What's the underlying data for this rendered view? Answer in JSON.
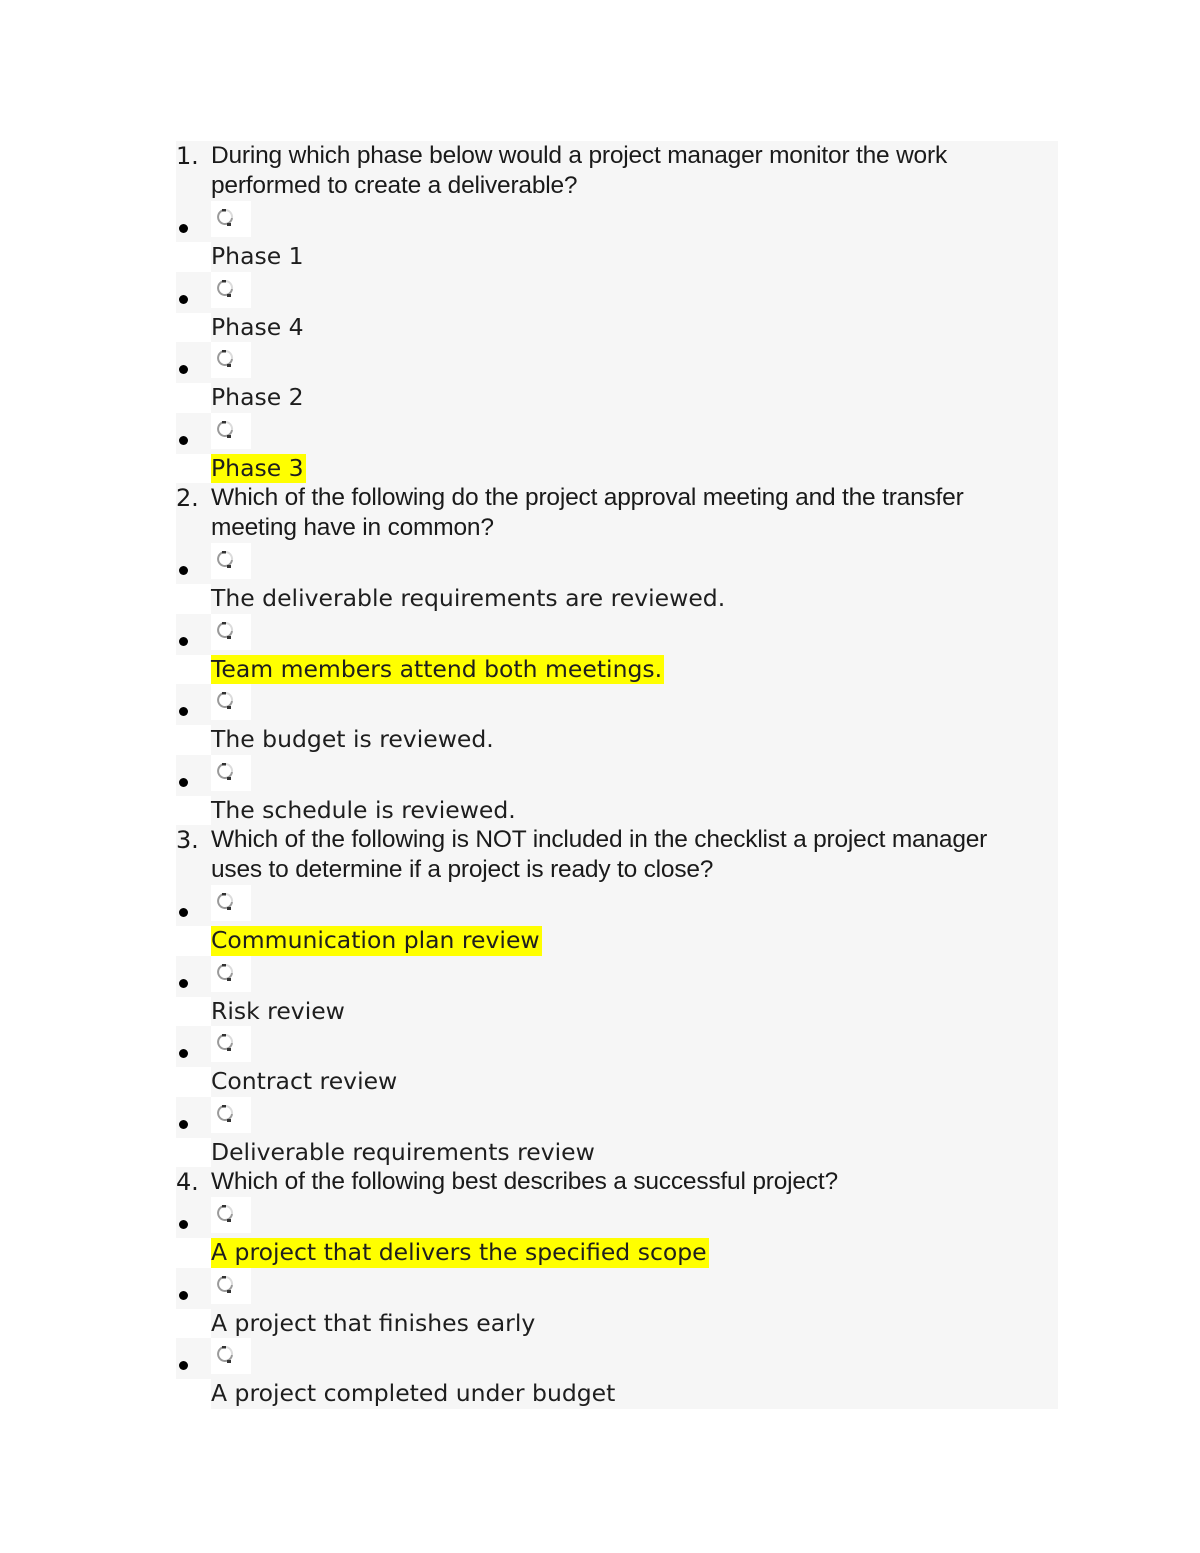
{
  "highlight_color": "#ffff00",
  "questions": [
    {
      "number": "1.",
      "lines": [
        "During which phase below would a project manager monitor the work",
        "performed to create a deliverable?"
      ],
      "options": [
        {
          "label": "Phase 1",
          "highlighted": false
        },
        {
          "label": "Phase 4",
          "highlighted": false
        },
        {
          "label": "Phase 2",
          "highlighted": false
        },
        {
          "label": "Phase 3",
          "highlighted": true
        }
      ]
    },
    {
      "number": "2.",
      "lines": [
        "Which of the following do the project approval meeting and the transfer",
        "meeting have in common?"
      ],
      "options": [
        {
          "label": "The deliverable requirements are reviewed.",
          "highlighted": false
        },
        {
          "label": "Team members attend both meetings.",
          "highlighted": true
        },
        {
          "label": "The budget is reviewed.",
          "highlighted": false
        },
        {
          "label": "The schedule is reviewed.",
          "highlighted": false
        }
      ]
    },
    {
      "number": "3.",
      "lines": [
        "Which of the following is NOT included in the checklist a project manager",
        "uses to determine if a project is ready to close?"
      ],
      "options": [
        {
          "label": "Communication plan review",
          "highlighted": true
        },
        {
          "label": "Risk review",
          "highlighted": false
        },
        {
          "label": "Contract review",
          "highlighted": false
        },
        {
          "label": "Deliverable requirements review",
          "highlighted": false
        }
      ]
    },
    {
      "number": "4.",
      "lines": [
        "Which of the following best describes a successful project?"
      ],
      "options": [
        {
          "label": "A project that delivers the specified scope",
          "highlighted": true
        },
        {
          "label": "A project that finishes early",
          "highlighted": false
        },
        {
          "label": "A project completed under budget",
          "highlighted": false
        }
      ]
    }
  ],
  "icons": {
    "radio": "radio-button-icon",
    "bullet": "bullet-icon"
  }
}
